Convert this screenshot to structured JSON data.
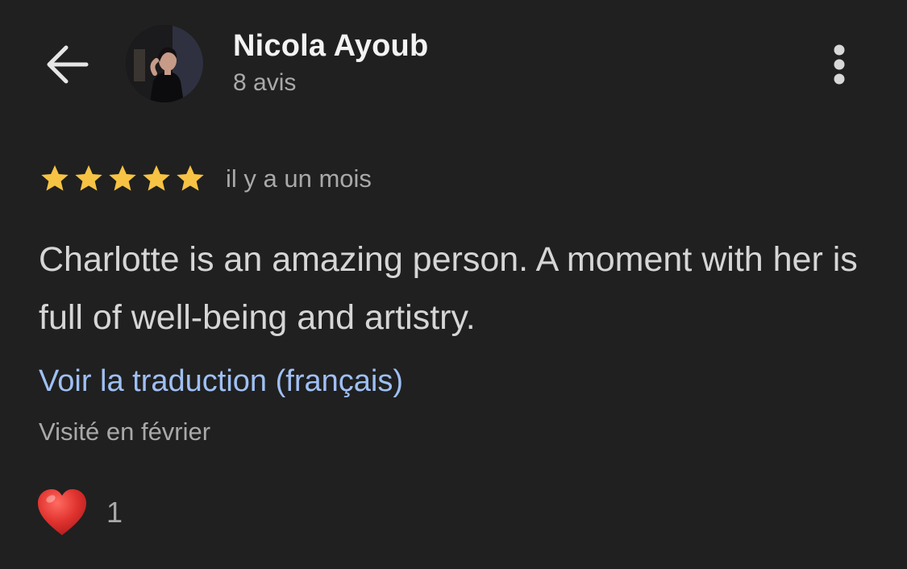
{
  "header": {
    "author_name": "Nicola Ayoub",
    "review_count": "8 avis",
    "back_icon": "arrow-left-icon",
    "more_icon": "more-vert-icon"
  },
  "review": {
    "rating": 5,
    "rating_max": 5,
    "date": "il y a un mois",
    "text": "Charlotte is an amazing person. A moment with her is full of well-being and artistry.",
    "translate_link": "Voir la traduction (français)",
    "visit_info": "Visité en février"
  },
  "reactions": {
    "icon": "heart-icon",
    "count": "1"
  },
  "colors": {
    "background": "#202020",
    "star": "#f6c344",
    "link": "#9fc0f4",
    "heart": "#e0332f",
    "secondary_text": "#a9a9a9"
  }
}
